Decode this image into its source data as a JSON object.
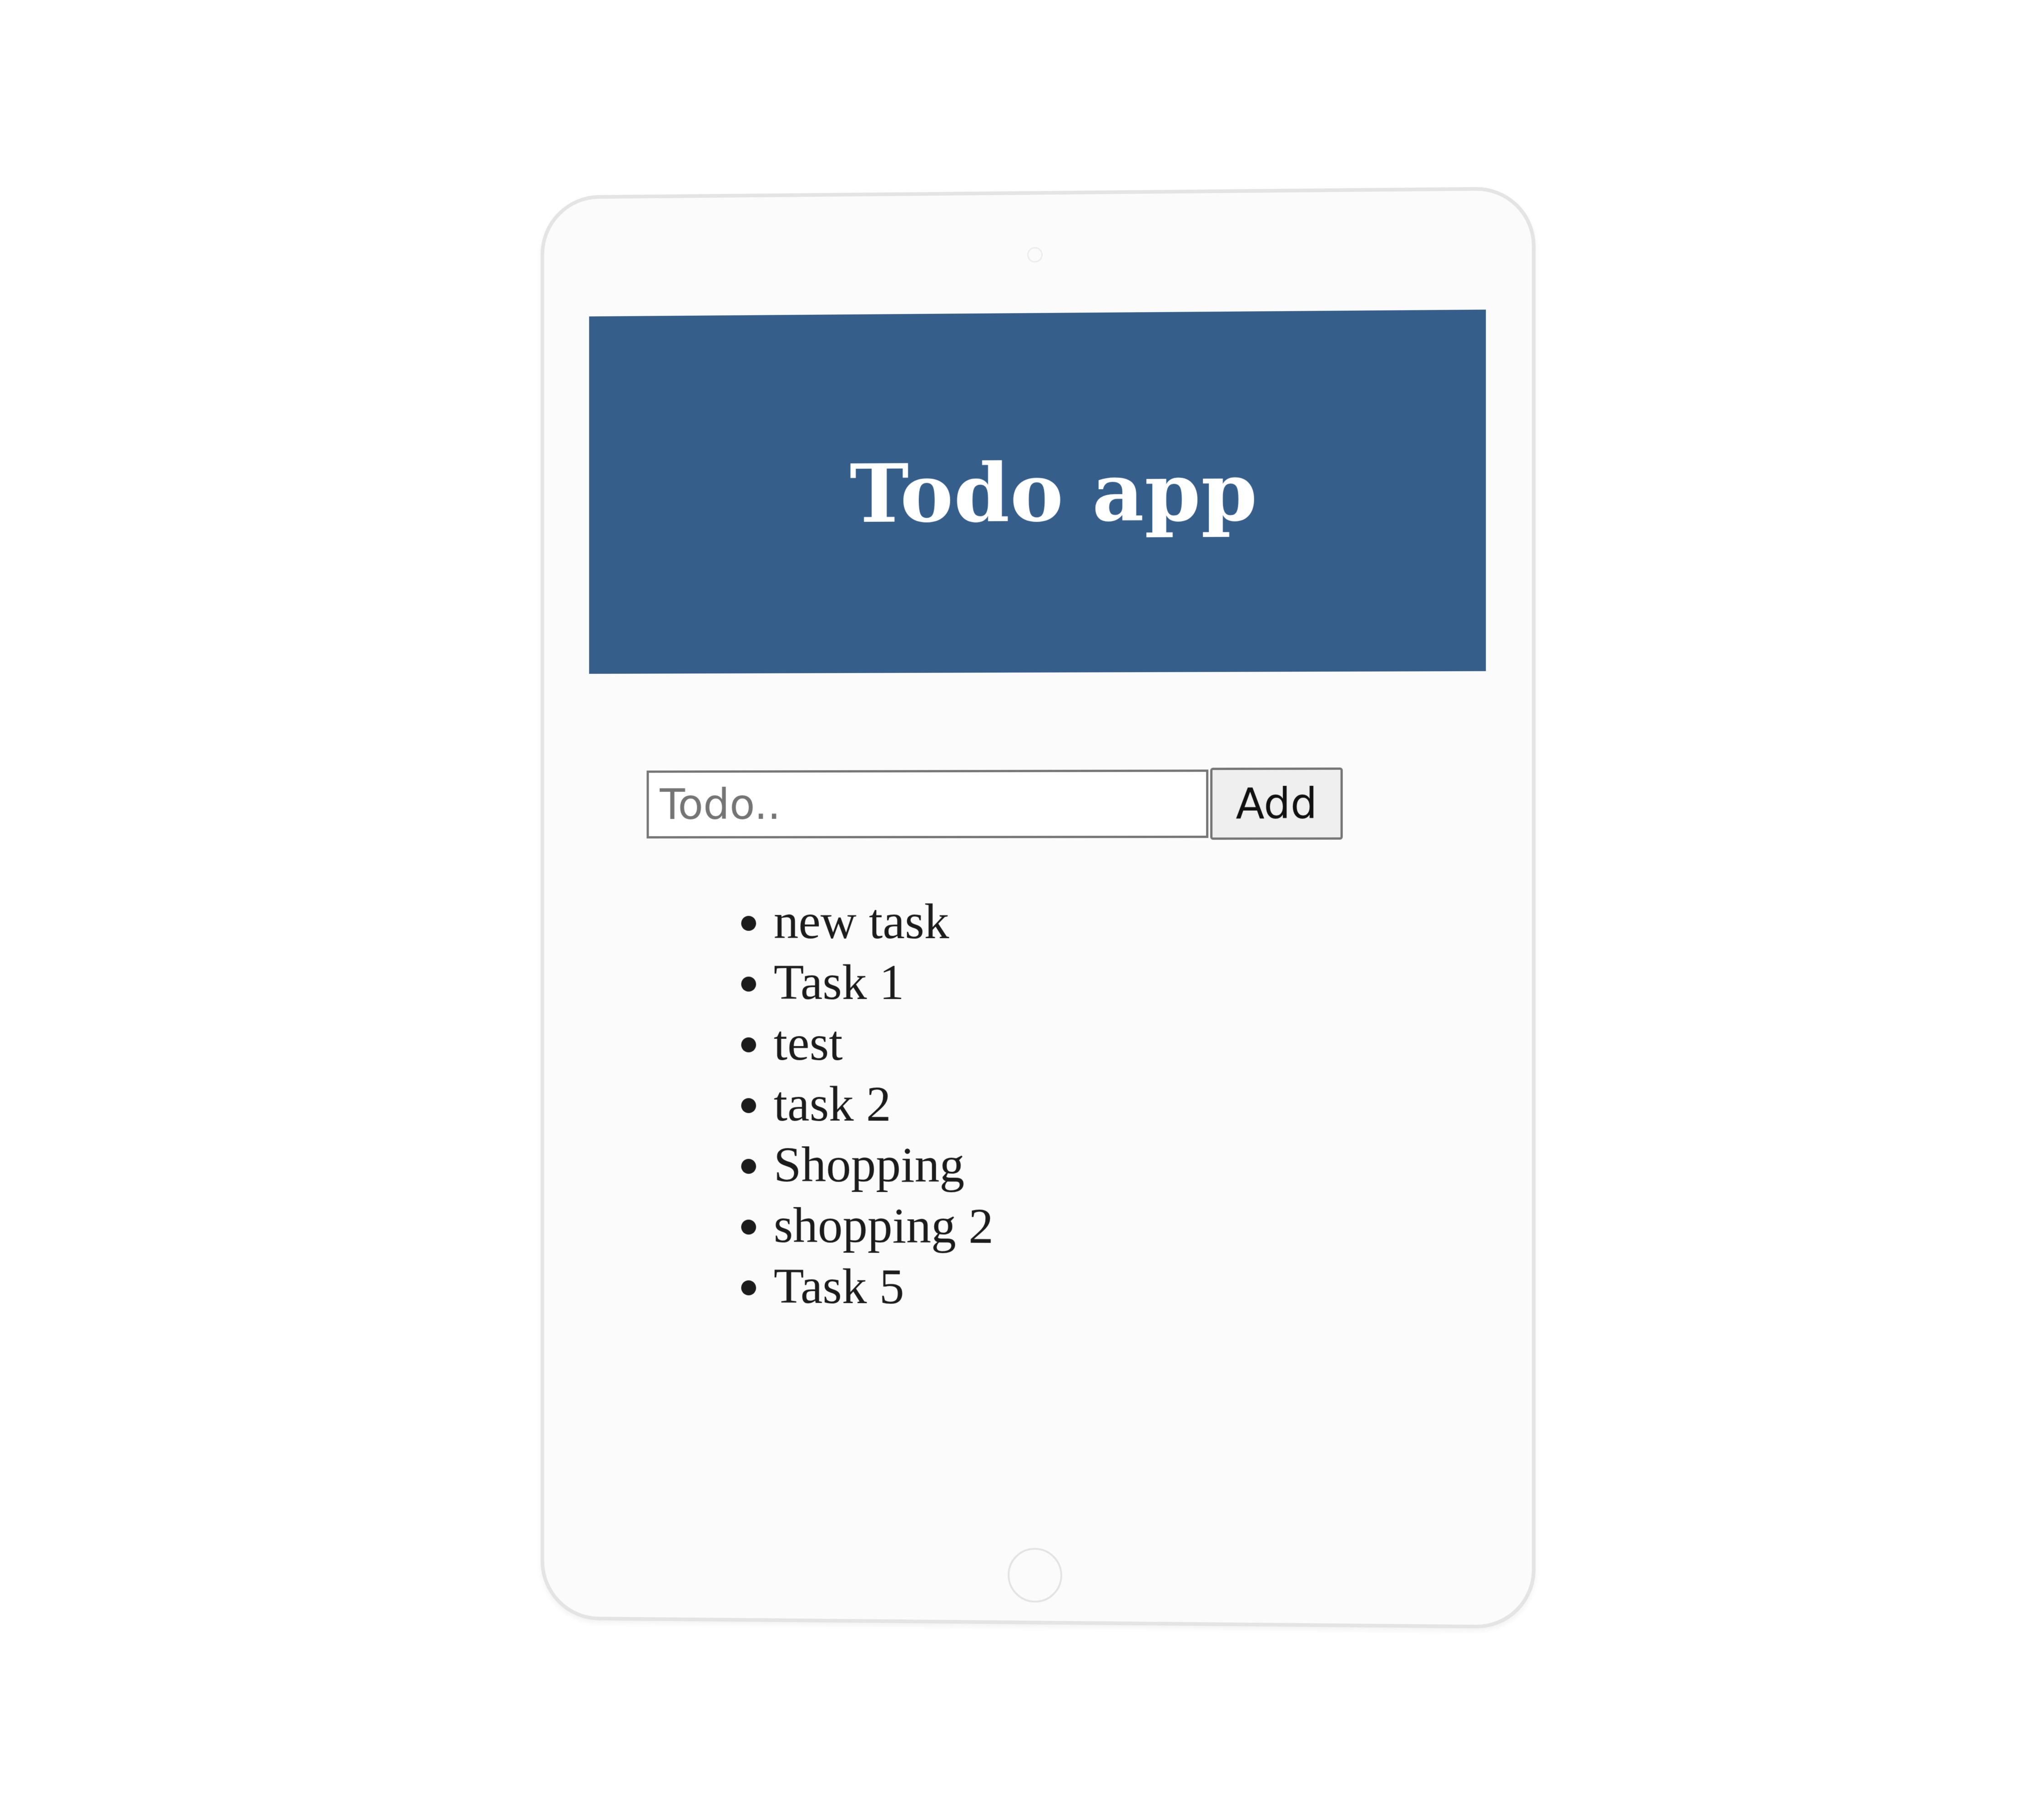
{
  "app": {
    "title": "Todo app",
    "header_color": "#365e8b"
  },
  "form": {
    "input_placeholder": "Todo..",
    "input_value": "",
    "add_label": "Add"
  },
  "todos": [
    {
      "label": "new task"
    },
    {
      "label": "Task 1"
    },
    {
      "label": "test"
    },
    {
      "label": "task 2"
    },
    {
      "label": "Shopping"
    },
    {
      "label": "shopping 2"
    },
    {
      "label": "Task 5"
    }
  ]
}
